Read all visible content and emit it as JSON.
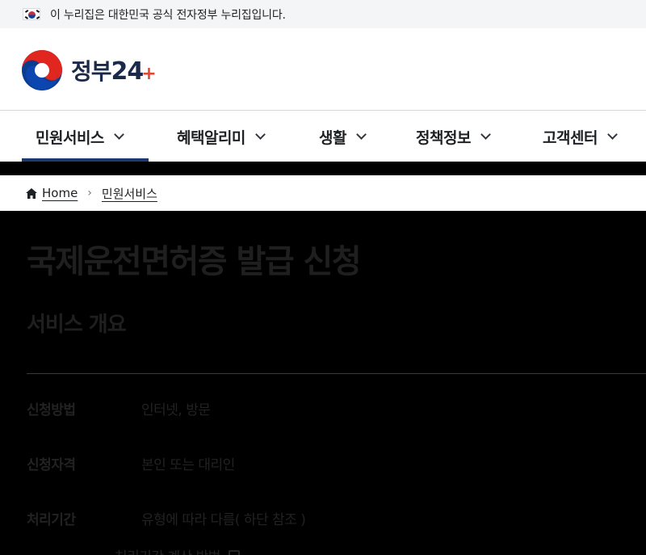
{
  "gov_banner": {
    "text": "이 누리집은 대한민국 공식 전자정부 누리집입니다.",
    "icon": "korea-flag-icon"
  },
  "header": {
    "logo_text": "정부",
    "logo_num": "24",
    "logo_plus": "+",
    "colors": {
      "navy": "#1c2a4a",
      "red": "#e2472f",
      "blue": "#0b50d0"
    }
  },
  "nav": {
    "items": [
      {
        "label": "민원서비스",
        "active": true
      },
      {
        "label": "혜택알리미",
        "active": false
      },
      {
        "label": "생활",
        "active": false
      },
      {
        "label": "정책정보",
        "active": false
      },
      {
        "label": "고객센터",
        "active": false
      }
    ]
  },
  "breadcrumb": {
    "home": "Home",
    "current": "민원서비스"
  },
  "main": {
    "title": "국제운전면허증 발급 신청",
    "section_title": "서비스 개요",
    "rows": [
      {
        "label": "신청방법",
        "value": "인터넷, 방문"
      },
      {
        "label": "신청자격",
        "value": "본인 또는 대리인"
      },
      {
        "label": "처리기간",
        "value": "유형에 따라 다름( 하단 참조 )"
      }
    ],
    "link_text": "처리기간 계산 방법"
  }
}
